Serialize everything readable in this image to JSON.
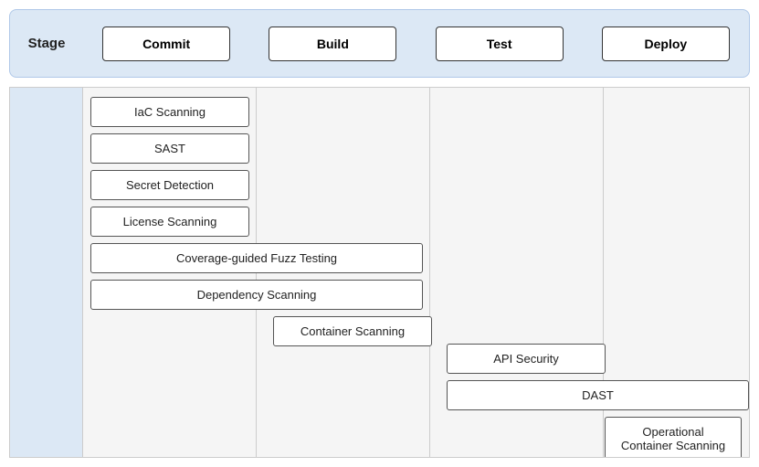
{
  "header": {
    "stage_label": "Stage",
    "columns": [
      {
        "id": "commit",
        "label": "Commit"
      },
      {
        "id": "build",
        "label": "Build"
      },
      {
        "id": "test",
        "label": "Test"
      },
      {
        "id": "deploy",
        "label": "Deploy"
      }
    ]
  },
  "items": {
    "commit": [
      {
        "id": "iac-scanning",
        "label": "IaC Scanning"
      },
      {
        "id": "sast",
        "label": "SAST"
      },
      {
        "id": "secret-detection",
        "label": "Secret Detection"
      },
      {
        "id": "license-scanning",
        "label": "License Scanning"
      }
    ],
    "commit_build_span": [
      {
        "id": "coverage-fuzz",
        "label": "Coverage-guided Fuzz Testing"
      },
      {
        "id": "dependency-scanning",
        "label": "Dependency Scanning"
      }
    ],
    "build": [
      {
        "id": "container-scanning",
        "label": "Container Scanning"
      }
    ],
    "test": [
      {
        "id": "api-security",
        "label": "API Security"
      }
    ],
    "test_deploy_span": [
      {
        "id": "dast",
        "label": "DAST"
      }
    ],
    "deploy": [
      {
        "id": "operational-container-scanning",
        "label": "Operational Container Scanning"
      }
    ]
  }
}
